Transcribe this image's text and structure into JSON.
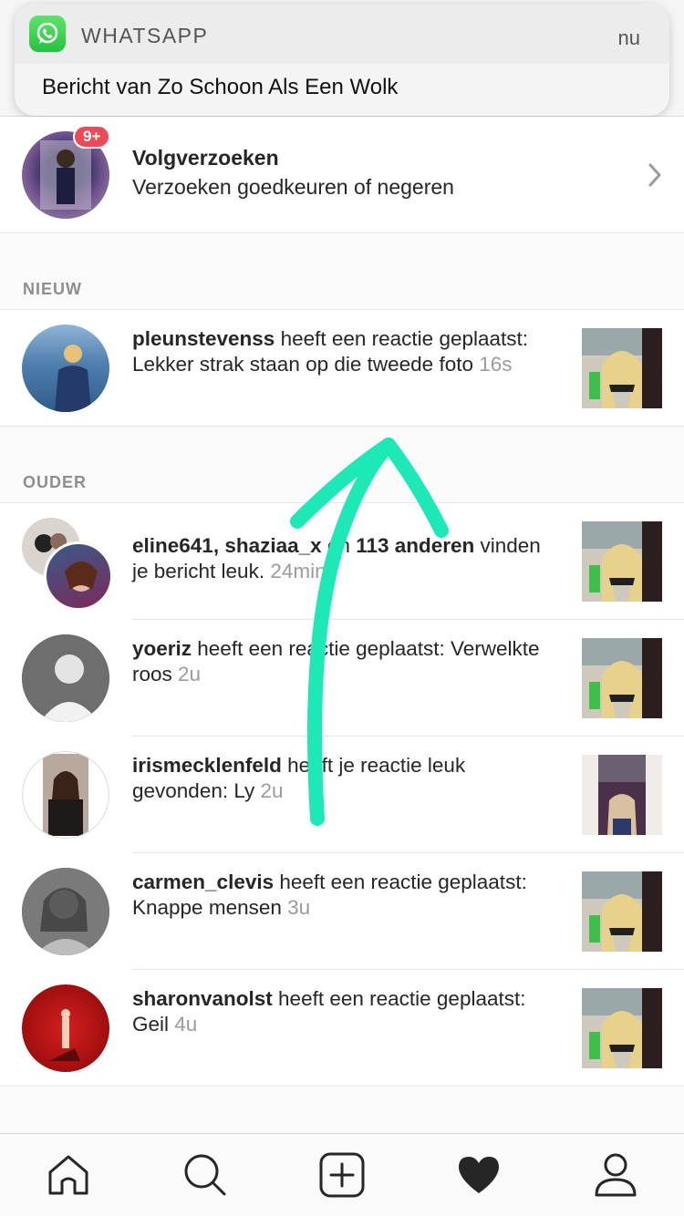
{
  "notification": {
    "app_name": "WHATSAPP",
    "time": "nu",
    "message": "Bericht van Zo Schoon Als Een Wolk",
    "icon": "whatsapp-icon"
  },
  "follow_requests": {
    "badge": "9+",
    "title": "Volgverzoeken",
    "subtitle": "Verzoeken goedkeuren of negeren",
    "icon": "chevron-right-icon"
  },
  "sections": {
    "new_label": "NIEUW",
    "old_label": "OUDER"
  },
  "new_items": [
    {
      "user": "pleunstevenss",
      "text": " heeft een reactie geplaatst: Lekker strak staan op die tweede foto",
      "time": "16s"
    }
  ],
  "old_items": [
    {
      "user": "eline641, shaziaa_x",
      "text": " en ",
      "extra_bold": "113 anderen",
      "text2": " vinden je bericht leuk.",
      "time": "24min."
    },
    {
      "user": "yoeriz",
      "text": " heeft een reactie geplaatst: Verwelkte roos",
      "time": "2u"
    },
    {
      "user": "irismecklenfeld",
      "text": " heeft je reactie leuk gevonden: Ly",
      "time": "2u"
    },
    {
      "user": "carmen_clevis",
      "text": " heeft een reactie geplaatst: Knappe mensen",
      "time": "3u"
    },
    {
      "user": "sharonvanolst",
      "text": " heeft een reactie geplaatst: Geil",
      "time": "4u"
    }
  ],
  "tabbar": {
    "icons": [
      "home-icon",
      "search-icon",
      "add-post-icon",
      "heart-icon",
      "profile-icon"
    ],
    "active": "heart-icon"
  },
  "colors": {
    "badge": "#ed4956",
    "annotation_arrow": "#1de9b6",
    "timestamp": "#9b9b9b"
  }
}
